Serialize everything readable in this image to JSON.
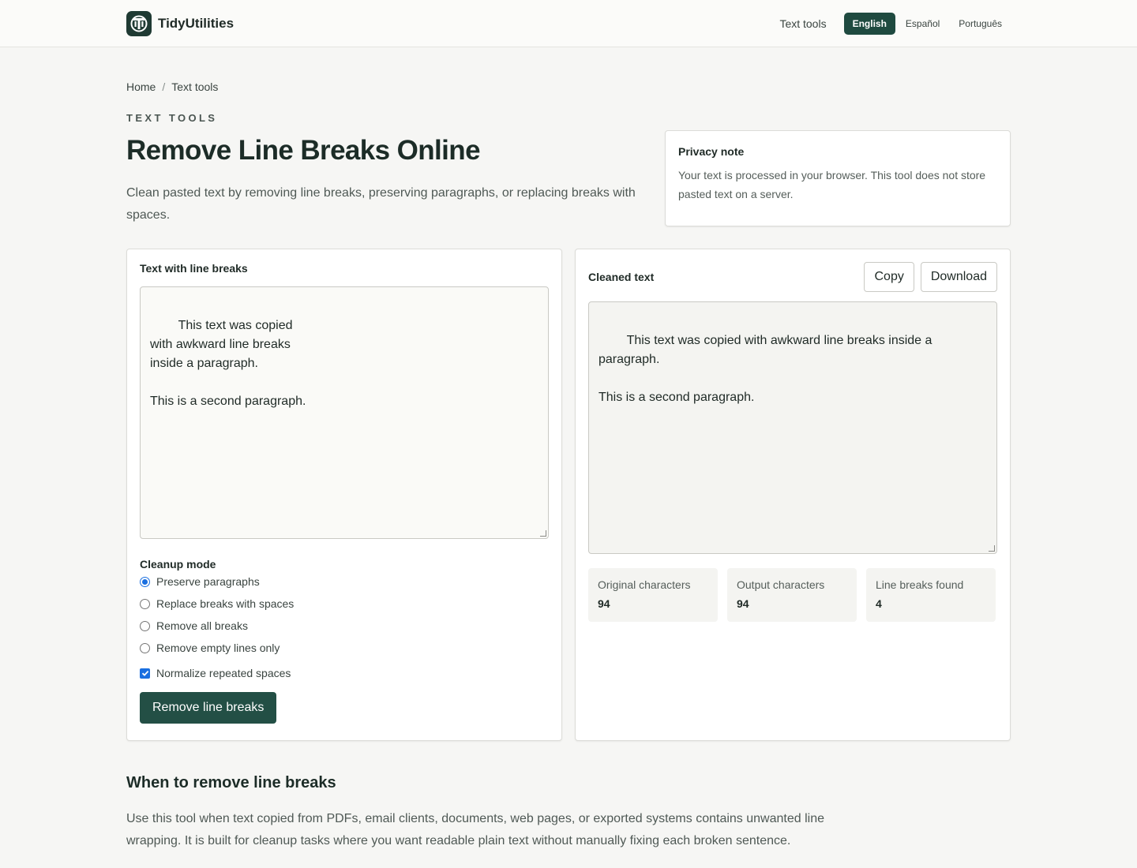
{
  "header": {
    "brand": "TidyUtilities",
    "nav_text_tools": "Text tools",
    "languages": [
      "English",
      "Español",
      "Português"
    ],
    "active_language": "English"
  },
  "breadcrumb": {
    "home": "Home",
    "separator": "/",
    "current": "Text tools"
  },
  "eyebrow": "TEXT TOOLS",
  "title": "Remove Line Breaks Online",
  "subtitle": "Clean pasted text by removing line breaks, preserving paragraphs, or replacing breaks with spaces.",
  "privacy": {
    "title": "Privacy note",
    "body": "Your text is processed in your browser. This tool does not store pasted text on a server."
  },
  "input": {
    "label": "Text with line breaks",
    "value": "This text was copied\nwith awkward line breaks\ninside a paragraph.\n\nThis is a second paragraph."
  },
  "cleanup": {
    "label": "Cleanup mode",
    "options": [
      "Preserve paragraphs",
      "Replace breaks with spaces",
      "Remove all breaks",
      "Remove empty lines only"
    ],
    "selected": "Preserve paragraphs",
    "normalize_label": "Normalize repeated spaces",
    "normalize_checked": true,
    "submit_label": "Remove line breaks"
  },
  "output": {
    "label": "Cleaned text",
    "copy_label": "Copy",
    "download_label": "Download",
    "value": "This text was copied with awkward line breaks inside a paragraph.\n\nThis is a second paragraph."
  },
  "stats": [
    {
      "label": "Original characters",
      "value": "94"
    },
    {
      "label": "Output characters",
      "value": "94"
    },
    {
      "label": "Line breaks found",
      "value": "4"
    }
  ],
  "info": {
    "heading": "When to remove line breaks",
    "paragraph1": "Use this tool when text copied from PDFs, email clients, documents, web pages, or exported systems contains unwanted line wrapping. It is built for cleanup tasks where you want readable plain text without manually fixing each broken sentence."
  },
  "colors": {
    "brand": "#1f3a33",
    "primary_button": "#234f45",
    "accent_blue": "#1a6fe0"
  }
}
